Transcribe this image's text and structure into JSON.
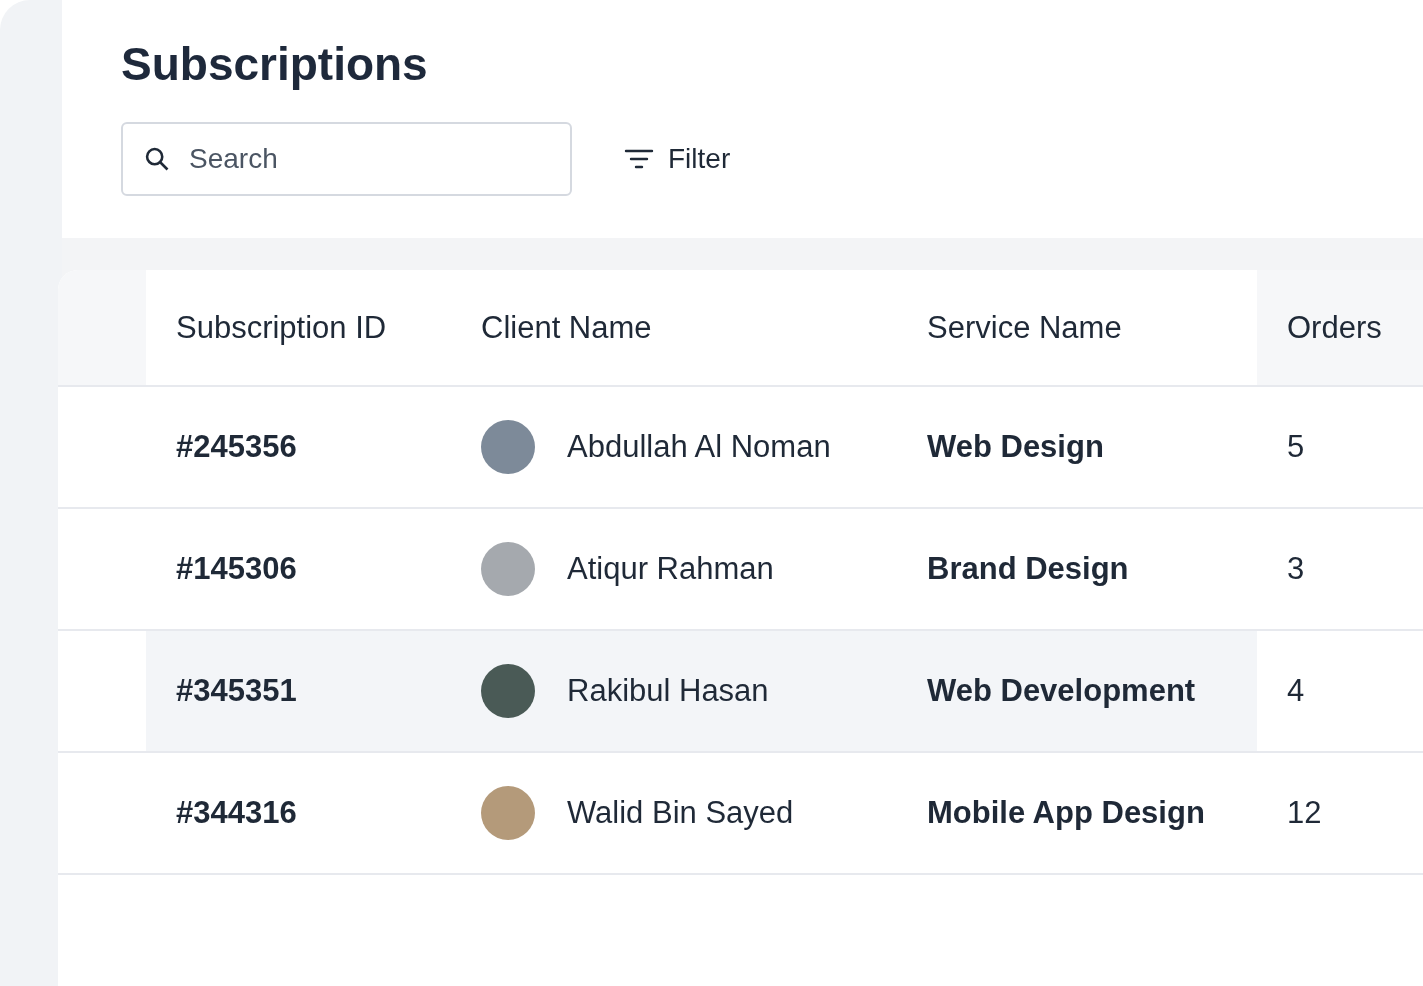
{
  "page": {
    "title": "Subscriptions"
  },
  "search": {
    "placeholder": "Search"
  },
  "filter": {
    "label": "Filter"
  },
  "table": {
    "columns": [
      "Subscription ID",
      "Client Name",
      "Service Name",
      "Orders"
    ],
    "rows": [
      {
        "id": "#245356",
        "client": "Abdullah Al Noman",
        "service": "Web Design",
        "orders": "5",
        "selected": false
      },
      {
        "id": "#145306",
        "client": "Atiqur Rahman",
        "service": "Brand Design",
        "orders": "3",
        "selected": false
      },
      {
        "id": "#345351",
        "client": "Rakibul Hasan",
        "service": "Web Development",
        "orders": "4",
        "selected": true
      },
      {
        "id": "#344316",
        "client": "Walid Bin Sayed",
        "service": "Mobile App Design",
        "orders": "12",
        "selected": false
      }
    ]
  }
}
